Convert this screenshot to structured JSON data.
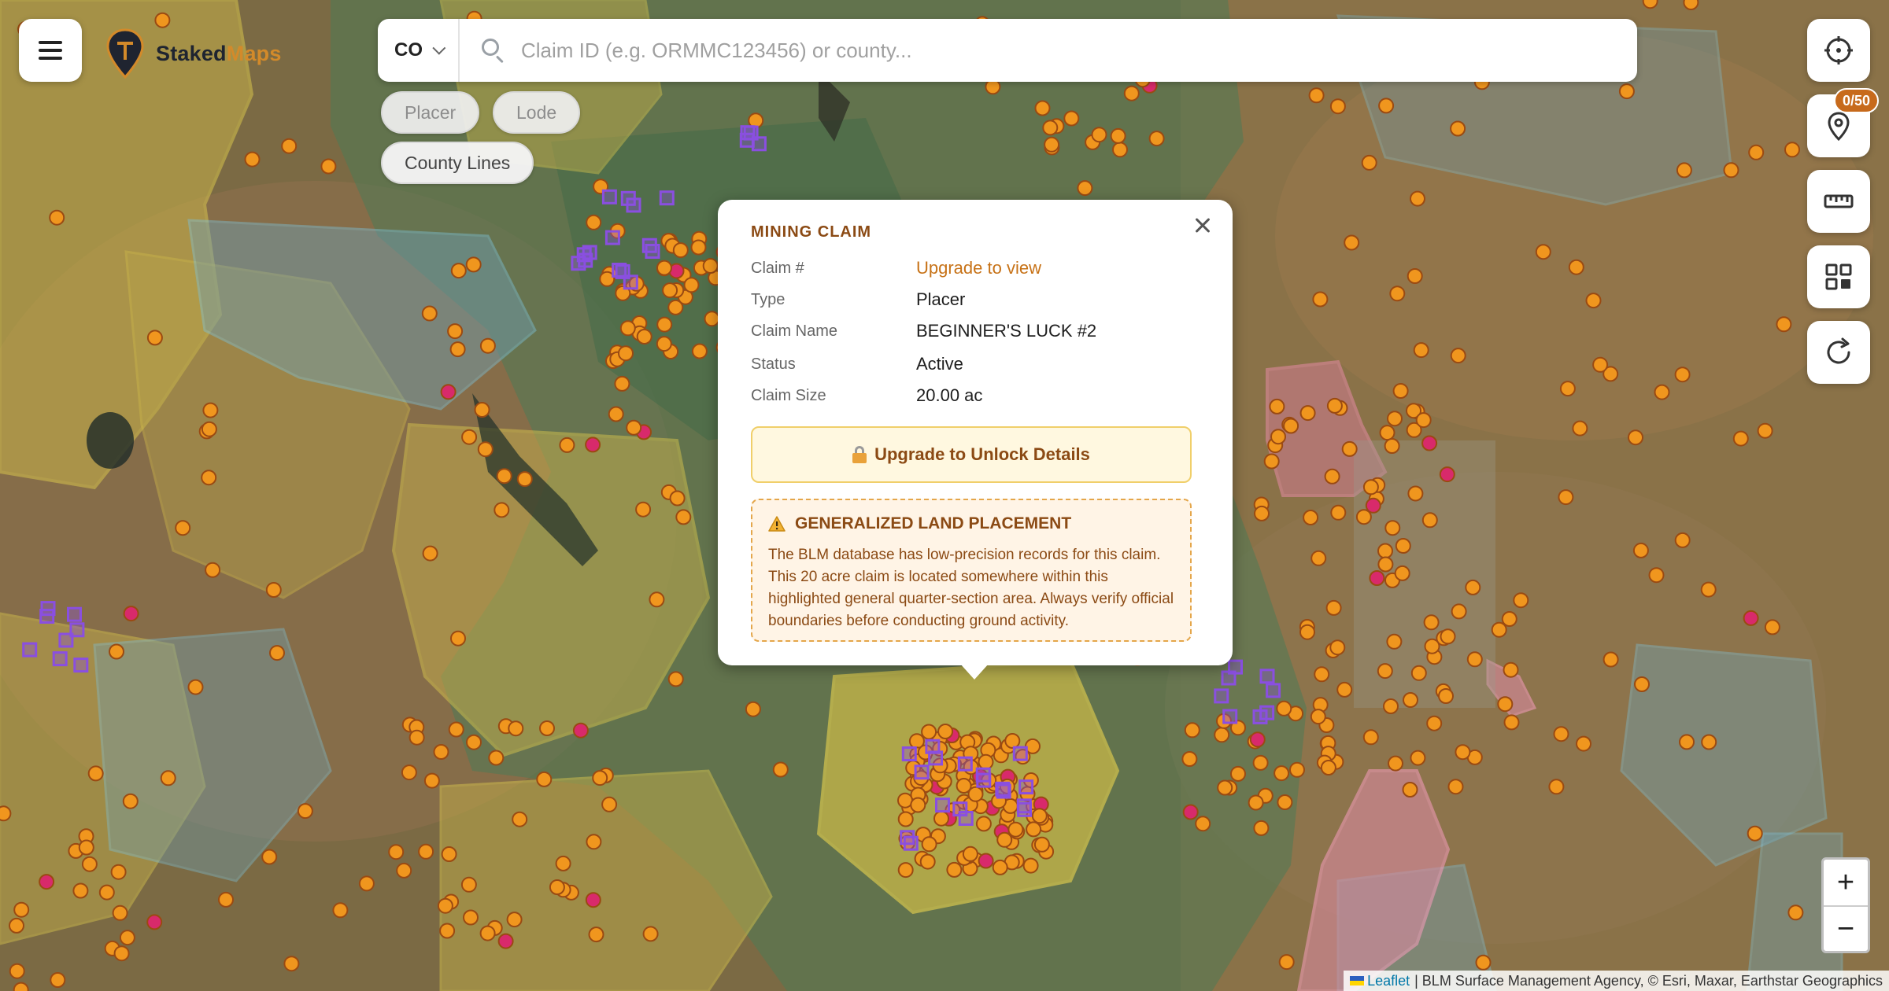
{
  "app": {
    "name_part1": "Staked",
    "name_part2": "Maps"
  },
  "search": {
    "state": "CO",
    "placeholder": "Claim ID (e.g. ORMMC123456) or county..."
  },
  "filters": [
    {
      "label": "Placer",
      "active": false
    },
    {
      "label": "Lode",
      "active": false
    },
    {
      "label": "County Lines",
      "active": true
    }
  ],
  "controls": {
    "pin_count": "0/50"
  },
  "icons": {
    "menu": "hamburger-icon",
    "logo": "map-pin-logo-icon",
    "locate": "crosshair-icon",
    "pins": "location-pin-icon",
    "measure": "ruler-icon",
    "layers": "grid-icon",
    "refresh": "refresh-icon",
    "close": "close-icon",
    "lock": "lock-icon",
    "warning": "warning-icon"
  },
  "zoom": {
    "in": "+",
    "out": "−"
  },
  "attribution": {
    "leaflet": "Leaflet",
    "sources": "| BLM Surface Management Agency, © Esri, Maxar, Earthstar Geographics"
  },
  "popup": {
    "heading": "MINING CLAIM",
    "fields": [
      {
        "label": "Claim #",
        "value": "Upgrade to view"
      },
      {
        "label": "Type",
        "value": "Placer"
      },
      {
        "label": "Claim Name",
        "value": "BEGINNER'S LUCK #2"
      },
      {
        "label": "Status",
        "value": "Active"
      },
      {
        "label": "Claim Size",
        "value": "20.00 ac"
      }
    ],
    "upgrade_label": "Upgrade to Unlock Details",
    "warning_title": "GENERALIZED LAND PLACEMENT",
    "warning_text": "The BLM database has low-precision records for this claim. This 20 acre claim is located somewhere within this highlighted general quarter-section area. Always verify official boundaries before conducting ground activity."
  },
  "colors": {
    "accent": "#c77217",
    "brand_dark": "#1f2430",
    "brand_light": "#d38a2a",
    "claim_marker": "#f0961e",
    "claim_marker_active": "#d82a6b",
    "lode_square": "#8a4fe0"
  }
}
